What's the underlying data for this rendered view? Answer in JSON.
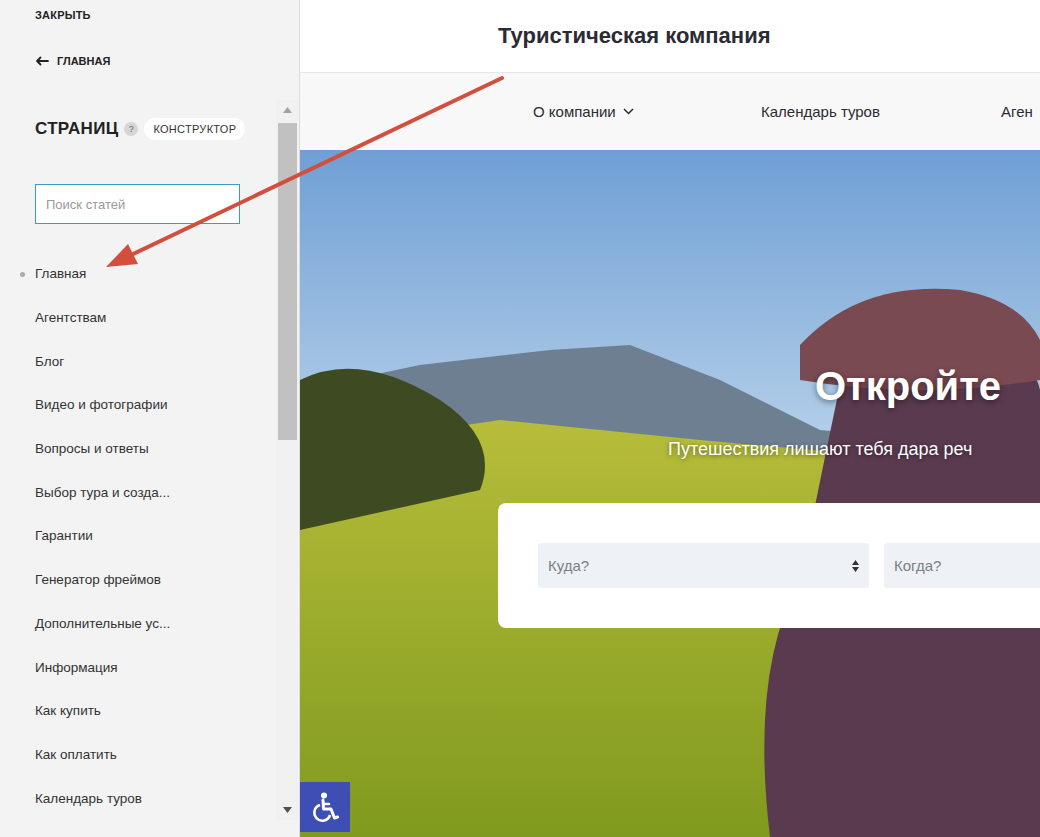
{
  "panel": {
    "close": "ЗАКРЫТЬ",
    "back": {
      "label": "ГЛАВНАЯ"
    },
    "title": "СТРАНИЦ",
    "help": "?",
    "mode": "КОНСТРУКТОР",
    "search": {
      "placeholder": "Поиск статей"
    },
    "pages": [
      {
        "label": "Главная",
        "selected": true
      },
      {
        "label": "Агентствам",
        "selected": false
      },
      {
        "label": "Блог",
        "selected": false
      },
      {
        "label": "Видео и фотографии",
        "selected": false
      },
      {
        "label": "Вопросы и ответы",
        "selected": false
      },
      {
        "label": "Выбор тура и созда...",
        "selected": false
      },
      {
        "label": "Гарантии",
        "selected": false
      },
      {
        "label": "Генератор фреймов",
        "selected": false
      },
      {
        "label": "Дополнительные ус...",
        "selected": false
      },
      {
        "label": "Информация",
        "selected": false
      },
      {
        "label": "Как купить",
        "selected": false
      },
      {
        "label": "Как оплатить",
        "selected": false
      },
      {
        "label": "Календарь туров",
        "selected": false
      }
    ]
  },
  "site": {
    "title": "Туристическая компания",
    "nav": [
      {
        "label": "О компании",
        "dropdown": true
      },
      {
        "label": "Календарь туров",
        "dropdown": false
      },
      {
        "label": "Аген",
        "dropdown": false
      }
    ],
    "hero": {
      "heading": "Откройте",
      "subtitle": "Путешествия лишают тебя дара реч"
    },
    "search_form": {
      "where": {
        "placeholder": "Куда?"
      },
      "when": {
        "placeholder": "Когда?"
      }
    }
  }
}
